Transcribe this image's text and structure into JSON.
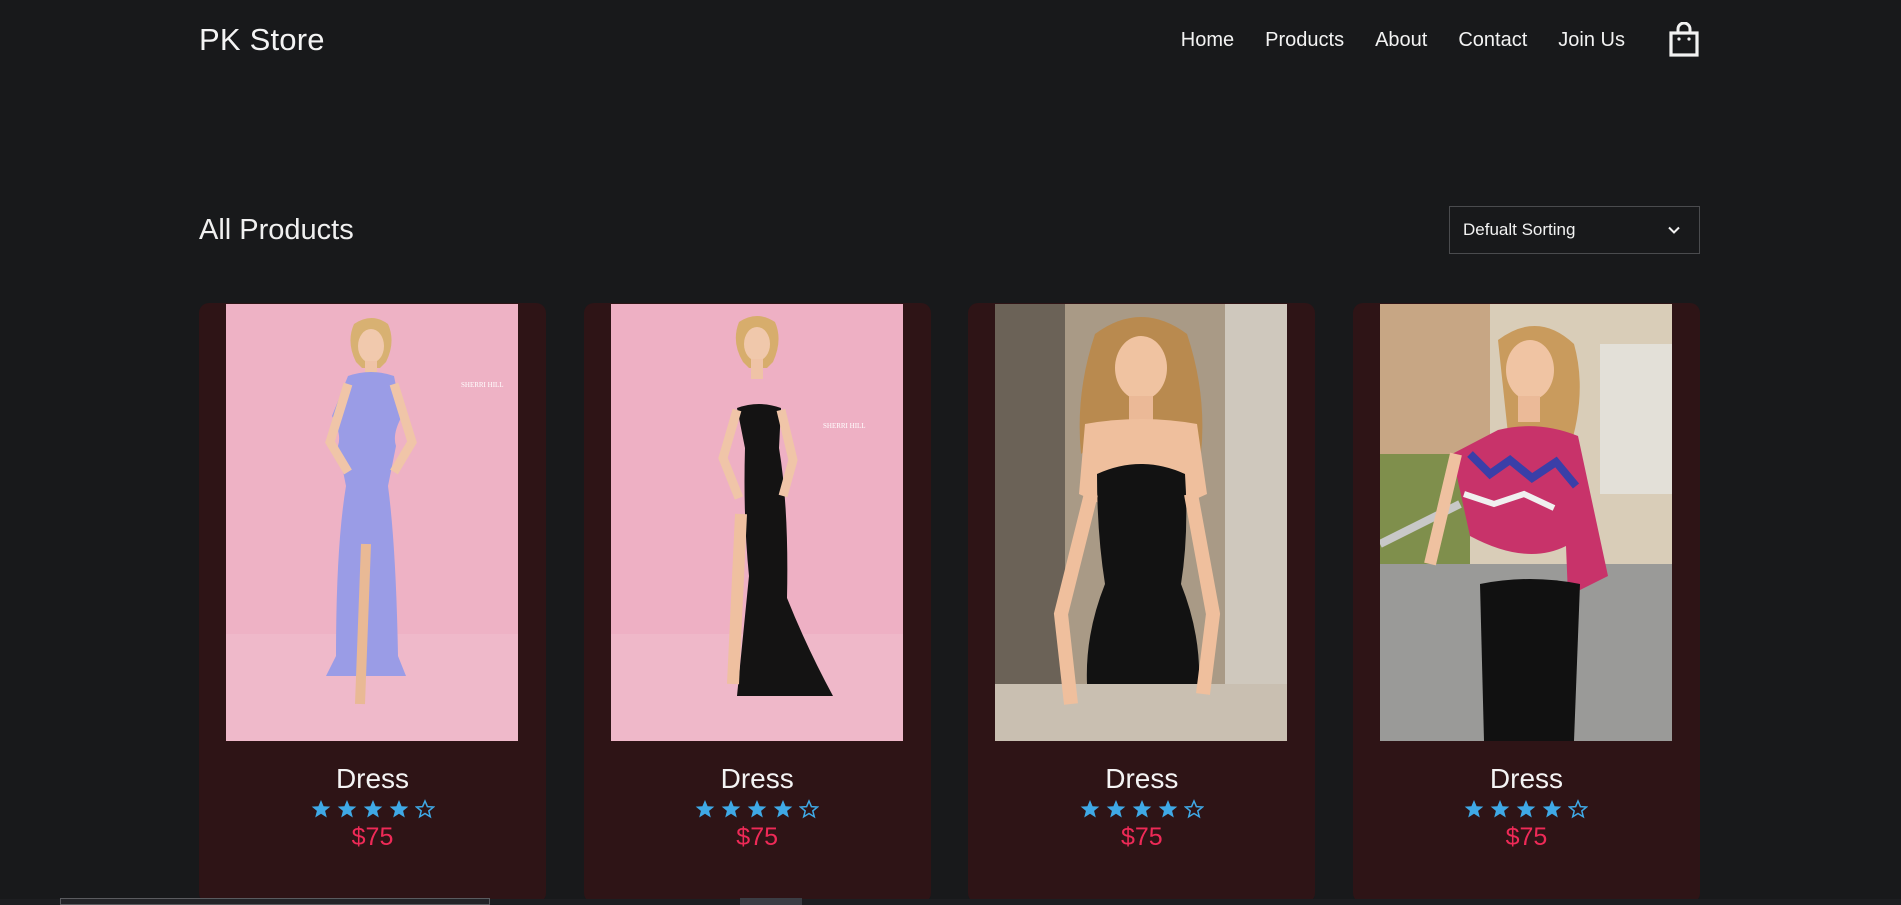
{
  "header": {
    "logo": "PK Store",
    "nav": [
      "Home",
      "Products",
      "About",
      "Contact",
      "Join Us"
    ],
    "cart_icon": "shopping-bag-icon"
  },
  "main": {
    "title": "All Products",
    "sort": {
      "selected": "Defualt Sorting",
      "icon": "chevron-down-icon"
    }
  },
  "products": [
    {
      "name": "Dress",
      "rating": 4,
      "max_rating": 5,
      "price": "$75",
      "image": "model in lilac sequin gown on pink backdrop"
    },
    {
      "name": "Dress",
      "rating": 4,
      "max_rating": 5,
      "price": "$75",
      "image": "model in black strapless gown on pink backdrop"
    },
    {
      "name": "Dress",
      "rating": 4,
      "max_rating": 5,
      "price": "$75",
      "image": "model in black lace mini dress on street"
    },
    {
      "name": "Dress",
      "rating": 4,
      "max_rating": 5,
      "price": "$75",
      "image": "model in mosaic one-shoulder top in city"
    }
  ],
  "colors": {
    "background": "#18191b",
    "card": "#2e1416",
    "star": "#3fa9e6",
    "price": "#ee2a57"
  }
}
